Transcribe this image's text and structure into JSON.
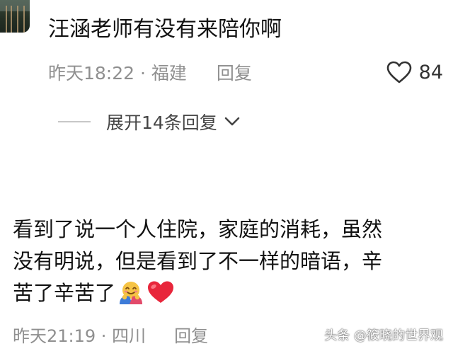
{
  "comment1": {
    "text": "汪涵老师有没有来陪你啊",
    "meta": "昨天18:22 · 福建",
    "reply_label": "回复",
    "like_count": "84",
    "expand_label": "展开14条回复"
  },
  "comment2": {
    "line1": "看到了说一个人住院，家庭的消耗，虽然",
    "line2": "没有明说，但是看到了不一样的暗语，辛",
    "line3": "苦了辛苦了",
    "emojis": [
      "hug-emoji",
      "red-heart-emoji"
    ],
    "meta": "昨天21:19 · 四川",
    "reply_label": "回复"
  },
  "watermark": "头条 @筱晓的世界观",
  "colors": {
    "meta_gray": "#8f8f8f",
    "heart_red": "#e8263b"
  }
}
